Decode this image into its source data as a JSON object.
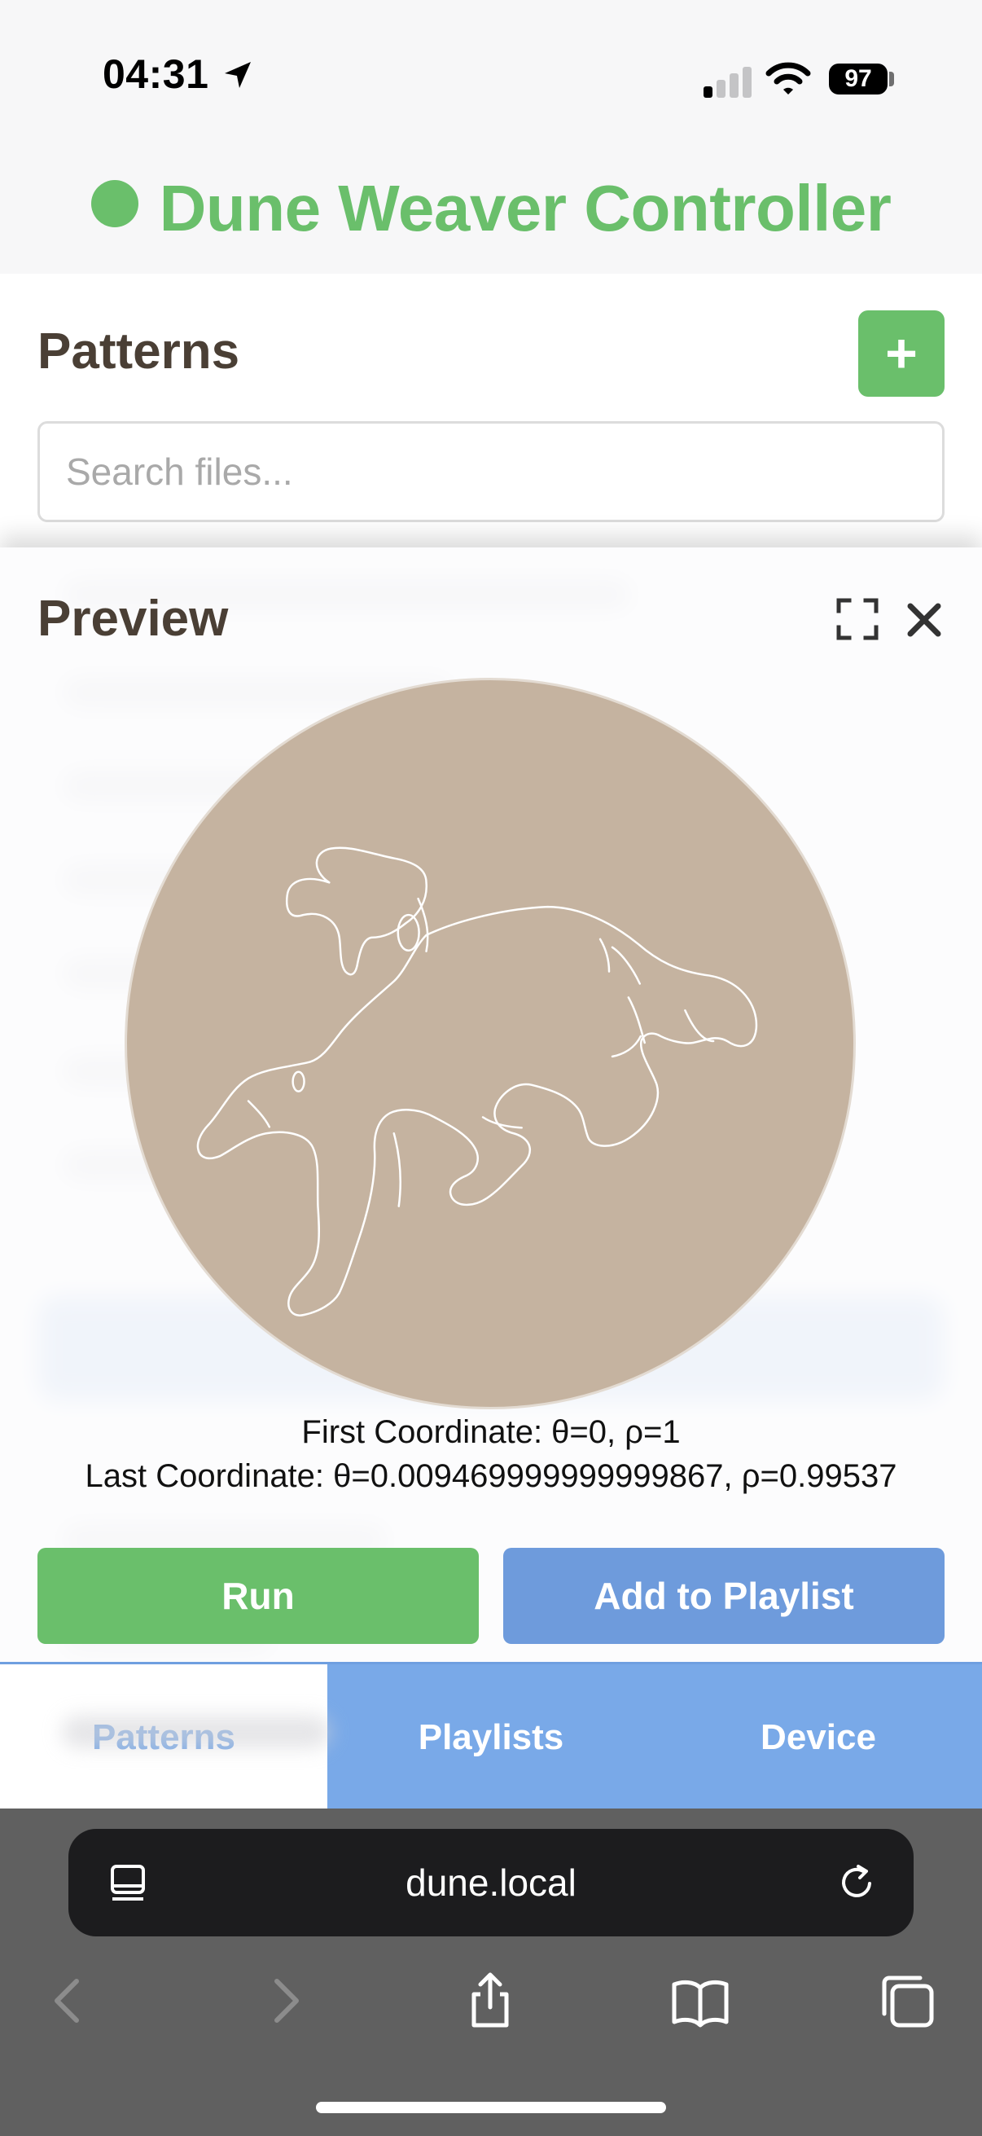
{
  "status_bar": {
    "time": "04:31",
    "battery": "97"
  },
  "app": {
    "title": "Dune Weaver Controller"
  },
  "patterns": {
    "title": "Patterns",
    "add_label": "+",
    "search_placeholder": "Search files..."
  },
  "preview": {
    "title": "Preview",
    "first_coordinate": "First Coordinate: θ=0, ρ=1",
    "last_coordinate": "Last Coordinate: θ=0.009469999999999867, ρ=0.99537",
    "run_label": "Run",
    "add_to_playlist_label": "Add to Playlist"
  },
  "tabs": [
    {
      "label": "Patterns",
      "active": true
    },
    {
      "label": "Playlists",
      "active": false
    },
    {
      "label": "Device",
      "active": false
    }
  ],
  "browser": {
    "url": "dune.local"
  },
  "colors": {
    "brand_green": "#6abf6b",
    "accent_blue": "#6e9bdc",
    "tab_blue": "#79a9e8",
    "sand": "#c5b3a0",
    "text_dark": "#4a3f35"
  },
  "icons": [
    "location-arrow-icon",
    "signal-icon",
    "wifi-icon",
    "battery-icon",
    "plus-icon",
    "fullscreen-icon",
    "close-icon",
    "reader-icon",
    "reload-icon",
    "back-icon",
    "forward-icon",
    "share-icon",
    "bookmarks-icon",
    "tabs-icon"
  ]
}
